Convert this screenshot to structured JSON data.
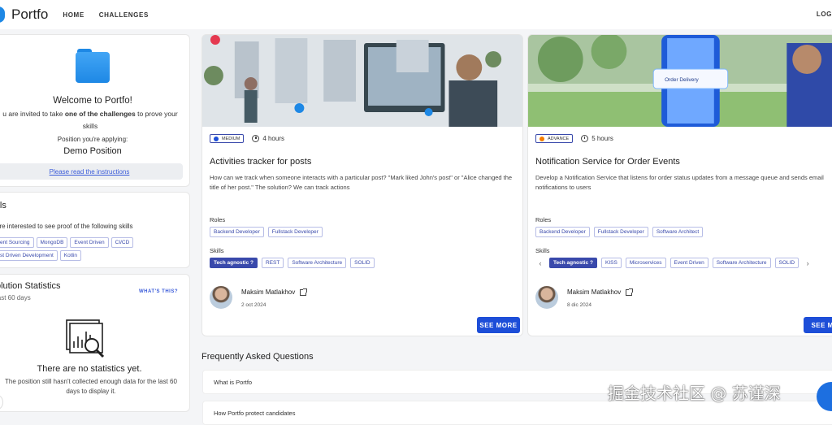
{
  "nav": {
    "logo": "Portfo",
    "home": "HOME",
    "challenges": "CHALLENGES",
    "login": "LOG"
  },
  "welcome": {
    "title": "Welcome to Portfo!",
    "desc_pre": "u are invited to take ",
    "desc_bold": "one of the challenges",
    "desc_post": " to prove your skills",
    "position_label": "Position you're applying:",
    "position": "Demo Position",
    "instructions_link": "Please read the instructions"
  },
  "skills": {
    "title": "ills",
    "desc": "are interested to see proof of the following skills",
    "items": [
      "ent Sourcing",
      "MongoDB",
      "Event Driven",
      "CI/CD",
      "st Driven Development",
      "Kotlin"
    ]
  },
  "stats": {
    "title": "olution Statistics",
    "subtitle": "last 60 days",
    "whats_this": "WHAT'S THIS?",
    "empty_title": "There are no statistics yet.",
    "empty_desc": "The position still hasn't collected enough data for the last 60 days to display it."
  },
  "cards": [
    {
      "level": "MEDIUM",
      "level_color": "#1d4ed8",
      "duration": "4 hours",
      "title": "Activities tracker for posts",
      "description": "How can we track when someone interacts with a particular post? \"Mark liked John's post\" or \"Alice changed the title of her post.\" The solution? We can track actions",
      "roles_label": "Roles",
      "roles": [
        "Backend Developer",
        "Fullstack Developer"
      ],
      "skills_label": "Skills",
      "primary_skill": "Tech agnostic  ?",
      "skills": [
        "REST",
        "Software Architecture",
        "SOLID"
      ],
      "author": "Maksim Matlakhov",
      "date": "2 oct 2024",
      "cta": "SEE MORE"
    },
    {
      "level": "ADVANCE",
      "level_color": "#f57c00",
      "duration": "5 hours",
      "title": "Notification Service for Order Events",
      "description": "Develop a Notification Service that listens for order status updates from a message queue and sends email notifications to users",
      "roles_label": "Roles",
      "roles": [
        "Backend Developer",
        "Fullstack Developer",
        "Software Architect"
      ],
      "skills_label": "Skills",
      "primary_skill": "Tech agnostic  ?",
      "skills": [
        "KISS",
        "Microservices",
        "Event Driven",
        "Software Architecture",
        "SOLID"
      ],
      "author": "Maksim Matlakhov",
      "date": "8 dic 2024",
      "cta": "SEE MO",
      "hero_text": "Order Delivery"
    }
  ],
  "faq": {
    "title": "Frequently Asked Questions",
    "items": [
      "What is Portfo",
      "How Portfo protect candidates"
    ]
  },
  "watermark": "掘金技术社区 @ 苏谨深"
}
